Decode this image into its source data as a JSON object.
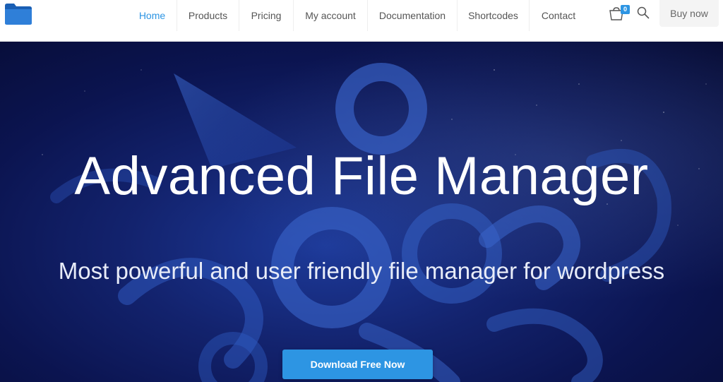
{
  "nav": {
    "items": [
      {
        "label": "Home",
        "active": true
      },
      {
        "label": "Products",
        "active": false
      },
      {
        "label": "Pricing",
        "active": false
      },
      {
        "label": "My account",
        "active": false
      },
      {
        "label": "Documentation",
        "active": false
      },
      {
        "label": "Shortcodes",
        "active": false
      },
      {
        "label": "Contact",
        "active": false
      }
    ],
    "cart_count": "0",
    "buy_label": "Buy now"
  },
  "icons": {
    "logo": "folder-icon",
    "cart": "cart-icon",
    "search": "search-icon"
  },
  "hero": {
    "title": "Advanced File Manager",
    "subtitle": "Most powerful and user friendly file manager for wordpress",
    "cta_label": "Download Free Now"
  },
  "colors": {
    "accent": "#2d95e3",
    "nav_text": "#555555",
    "hero_dark": "#0b1450",
    "hero_mid": "#1d3a9a"
  }
}
